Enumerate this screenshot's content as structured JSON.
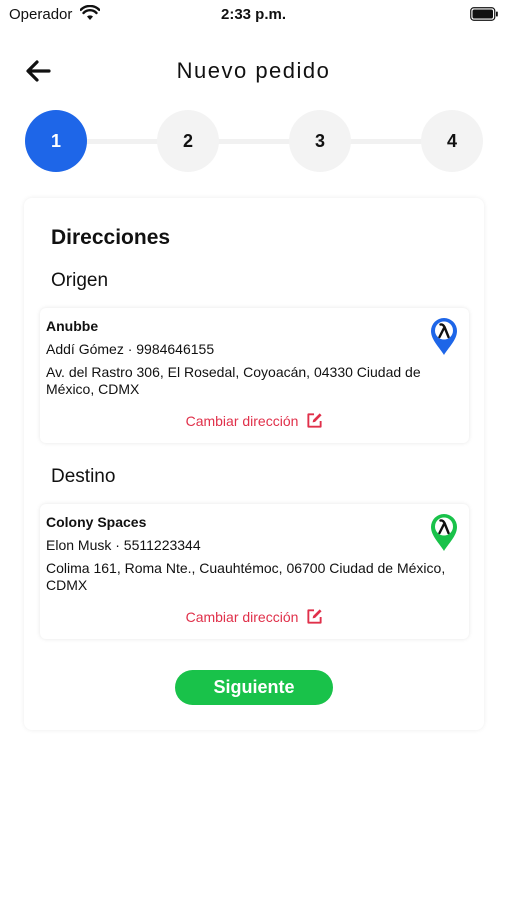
{
  "status_bar": {
    "carrier": "Operador",
    "time": "2:33 p.m.",
    "icons": [
      "wifi-icon",
      "battery-icon"
    ]
  },
  "nav": {
    "back_icon": "arrow-left-icon",
    "title": "Nuevo pedido"
  },
  "stepper": {
    "steps": [
      "1",
      "2",
      "3",
      "4"
    ],
    "active_step": "1",
    "active_color": "#1e66e8"
  },
  "main": {
    "section_title": "Direcciones",
    "origin": {
      "label": "Origen",
      "name": "Anubbe",
      "contact": "Addí Gómez · 9984646155",
      "address": "Av. del Rastro 306, El Rosedal, Coyoacán, 04330 Ciudad de México, CDMX",
      "pin_icon": "blue-lambda-pin-icon",
      "pin_color": "#1e66e8",
      "change_label": "Cambiar dirección",
      "change_icon": "edit-icon"
    },
    "destination": {
      "label": "Destino",
      "name": "Colony Spaces",
      "contact": "Elon Musk · 5511223344",
      "address": "Colima 161, Roma Nte., Cuauhtémoc, 06700 Ciudad de México, CDMX",
      "pin_icon": "green-lambda-pin-icon",
      "pin_color": "#19c24a",
      "change_label": "Cambiar dirección",
      "change_icon": "edit-icon"
    },
    "next_label": "Siguiente",
    "next_color": "#19c24a",
    "link_color": "#e0304a"
  }
}
